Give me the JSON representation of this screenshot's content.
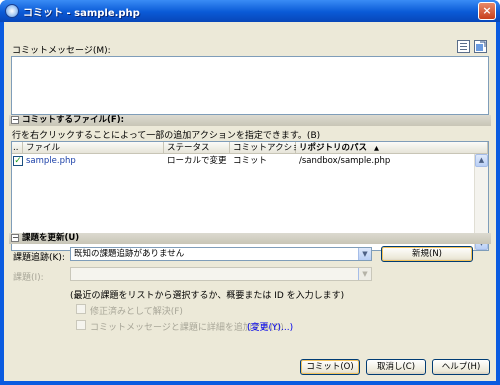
{
  "window": {
    "title": "コミット - sample.php",
    "close_glyph": "×"
  },
  "commit_message": {
    "label": "コミットメッセージ(M):",
    "value": "",
    "icons": [
      "message-template-icon",
      "message-history-icon"
    ]
  },
  "files_section": {
    "toggle": "⊟",
    "title": "コミットするファイル(F):",
    "hint": "行を右クリックすることによって一部の追加アクションを指定できます。(B)",
    "columns": [
      "..",
      "ファイル",
      "ステータス",
      "コミットアクション",
      "リポジトリのパス"
    ],
    "sort_indicator": "▲",
    "rows": [
      {
        "checked": true,
        "check_glyph": "✓",
        "file": "sample.php",
        "status": "ローカルで変更",
        "action": "コミット",
        "path": "/sandbox/sample.php"
      }
    ],
    "scroll_up": "▲",
    "scroll_down": "▼"
  },
  "issue_section": {
    "toggle": "⊟",
    "title": "課題を更新(U)",
    "tracker_label": "課題追跡(K):",
    "tracker_value": "既知の課題追跡がありません",
    "new_button": "新規(N)",
    "issue_label": "課題(I):",
    "issue_value": "",
    "info_text": "(最近の課題をリストから選択するか、概要または ID を入力します)",
    "resolve_label": "修正済みとして解決(F)",
    "add_details_label": "コミットメッセージと課題に詳細を追加する(D)",
    "change_link": "(変更(Y)...)",
    "dropdown_arrow": "▼"
  },
  "buttons": {
    "commit": "コミット(O)",
    "cancel": "取消し(C)",
    "help": "ヘルプ(H)"
  }
}
